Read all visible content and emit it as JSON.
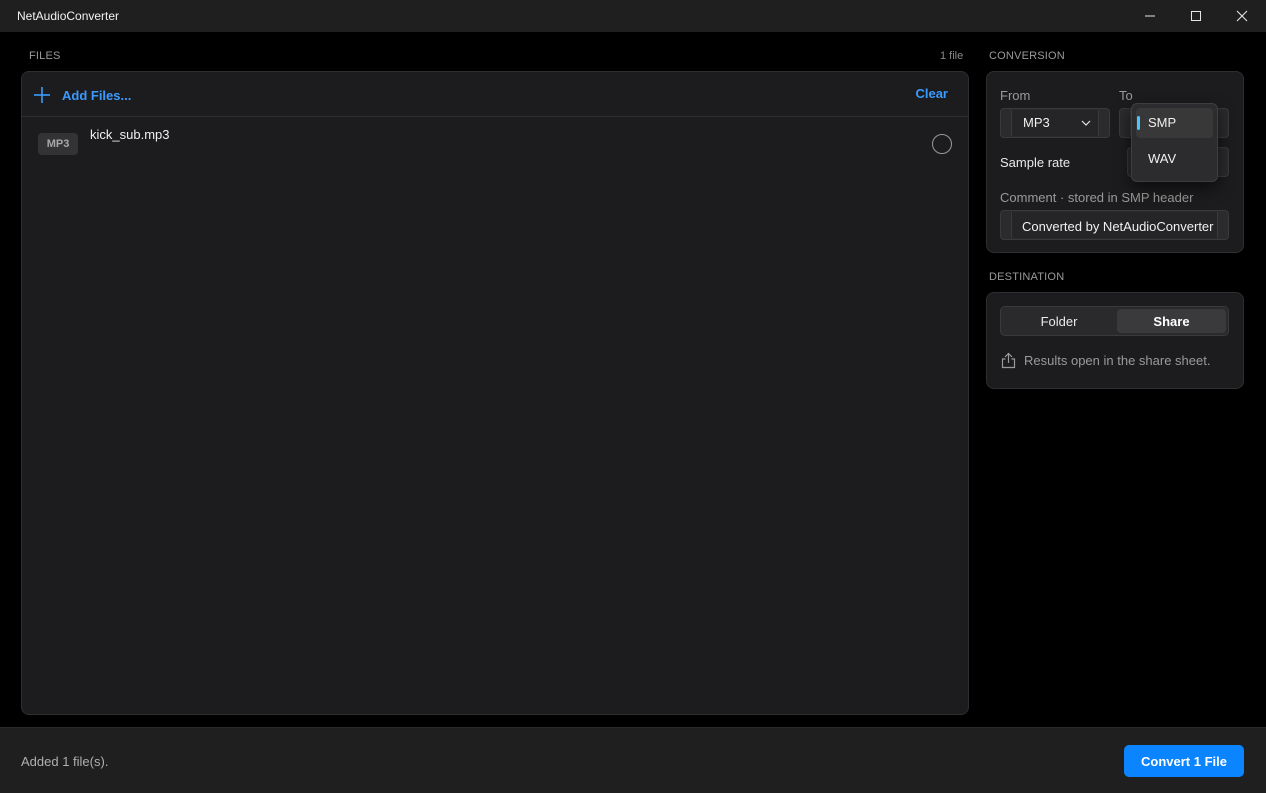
{
  "window": {
    "title": "NetAudioConverter"
  },
  "files": {
    "section_label": "FILES",
    "count_label": "1 file",
    "add_label": "Add Files...",
    "clear_label": "Clear",
    "items": [
      {
        "format": "MP3",
        "name": "kick_sub.mp3"
      }
    ]
  },
  "conversion": {
    "section_label": "CONVERSION",
    "from_label": "From",
    "from_value": "MP3",
    "to_label": "To",
    "sample_rate_label": "Sample rate",
    "comment_label": "Comment · stored in SMP header",
    "comment_value": "Converted by NetAudioConverter",
    "to_dropdown": {
      "options": [
        "SMP",
        "WAV"
      ],
      "selected": "SMP"
    }
  },
  "destination": {
    "section_label": "DESTINATION",
    "options": [
      "Folder",
      "Share"
    ],
    "selected": "Share",
    "info": "Results open in the share sheet."
  },
  "footer": {
    "status": "Added 1 file(s).",
    "convert_label": "Convert 1 File"
  },
  "colors": {
    "accent": "#0a84ff",
    "link": "#3a9bff",
    "selection_indicator": "#4cc2ff",
    "background": "#000000",
    "panel": "#1c1c1e"
  },
  "icons": {
    "add": "plus-icon",
    "chevron": "chevron-down-icon",
    "share": "share-icon",
    "minimize": "minimize-icon",
    "maximize": "maximize-icon",
    "close": "close-icon"
  }
}
